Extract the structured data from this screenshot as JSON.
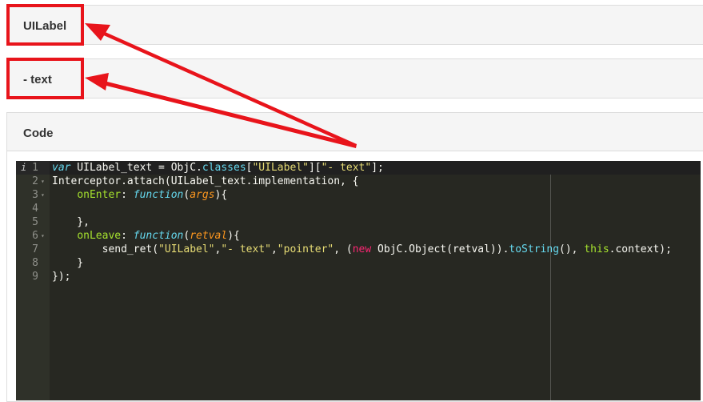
{
  "panels": {
    "class_title": "UILabel",
    "method_title": "- text",
    "code_title": "Code"
  },
  "annotation": {
    "highlight_color": "#e8141b"
  },
  "code": {
    "lines": [
      {
        "num": "1",
        "tokens": [
          {
            "t": "var",
            "c": "t-kw-storage"
          },
          {
            "t": " UILabel_text = ObjC."
          },
          {
            "t": "classes",
            "c": "t-support"
          },
          {
            "t": "["
          },
          {
            "t": "\"UILabel\"",
            "c": "t-str"
          },
          {
            "t": "]["
          },
          {
            "t": "\"- text\"",
            "c": "t-str"
          },
          {
            "t": "];"
          }
        ]
      },
      {
        "num": "2",
        "fold": true,
        "tokens": [
          {
            "t": "Interceptor.attach(UILabel_text.implementation, {"
          }
        ]
      },
      {
        "num": "3",
        "fold": true,
        "tokens": [
          {
            "t": "    "
          },
          {
            "t": "onEnter",
            "c": "t-fn"
          },
          {
            "t": ": "
          },
          {
            "t": "function",
            "c": "t-kw-storage"
          },
          {
            "t": "("
          },
          {
            "t": "args",
            "c": "t-param"
          },
          {
            "t": "){"
          }
        ]
      },
      {
        "num": "4",
        "tokens": [
          {
            "t": ""
          }
        ]
      },
      {
        "num": "5",
        "tokens": [
          {
            "t": "    },"
          }
        ]
      },
      {
        "num": "6",
        "fold": true,
        "tokens": [
          {
            "t": "    "
          },
          {
            "t": "onLeave",
            "c": "t-fn"
          },
          {
            "t": ": "
          },
          {
            "t": "function",
            "c": "t-kw-storage"
          },
          {
            "t": "("
          },
          {
            "t": "retval",
            "c": "t-param"
          },
          {
            "t": "){"
          }
        ]
      },
      {
        "num": "7",
        "tokens": [
          {
            "t": "        send_ret("
          },
          {
            "t": "\"UILabel\"",
            "c": "t-str"
          },
          {
            "t": ","
          },
          {
            "t": "\"- text\"",
            "c": "t-str"
          },
          {
            "t": ","
          },
          {
            "t": "\"pointer\"",
            "c": "t-str"
          },
          {
            "t": ", ("
          },
          {
            "t": "new",
            "c": "t-kw"
          },
          {
            "t": " ObjC.Object(retval))."
          },
          {
            "t": "toString",
            "c": "t-support"
          },
          {
            "t": "(), "
          },
          {
            "t": "this",
            "c": "t-this"
          },
          {
            "t": ".context);"
          }
        ]
      },
      {
        "num": "8",
        "tokens": [
          {
            "t": "    }"
          }
        ]
      },
      {
        "num": "9",
        "tokens": [
          {
            "t": "});"
          }
        ]
      }
    ]
  }
}
